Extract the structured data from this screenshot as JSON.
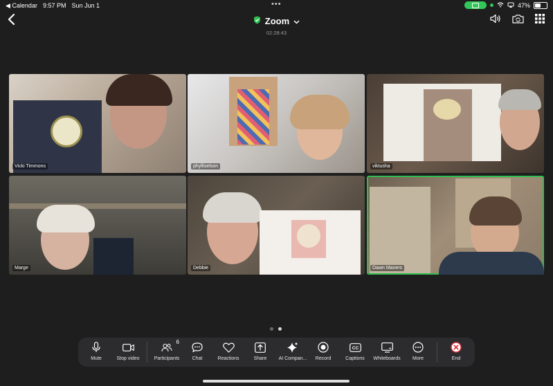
{
  "status_bar": {
    "back_app": "◀ Calendar",
    "time": "9:57 PM",
    "date": "Sun Jun 1",
    "battery": "47%",
    "battery_level": 0.47
  },
  "header": {
    "title": "Zoom",
    "timer": "02:28:43"
  },
  "participants": [
    {
      "name": "Vicki Timmons",
      "active": false
    },
    {
      "name": "phylliselson",
      "active": false
    },
    {
      "name": "viktusha",
      "active": false
    },
    {
      "name": "Marge",
      "active": false
    },
    {
      "name": "Debbie",
      "active": false
    },
    {
      "name": "Dawn Maners",
      "active": true
    }
  ],
  "toolbar": {
    "mute": "Mute",
    "stop_video": "Stop video",
    "participants": "Participants",
    "participants_count": "6",
    "chat": "Chat",
    "reactions": "Reactions",
    "share": "Share",
    "ai_companion": "AI Compan...",
    "record": "Record",
    "captions": "Captions",
    "whiteboards": "Whiteboards",
    "more": "More",
    "end": "End"
  },
  "colors": {
    "accent_green": "#32c759",
    "active_speaker": "#2fbf4f",
    "end_red": "#e0323b"
  },
  "pagination": {
    "pages": 2,
    "current": 2
  }
}
